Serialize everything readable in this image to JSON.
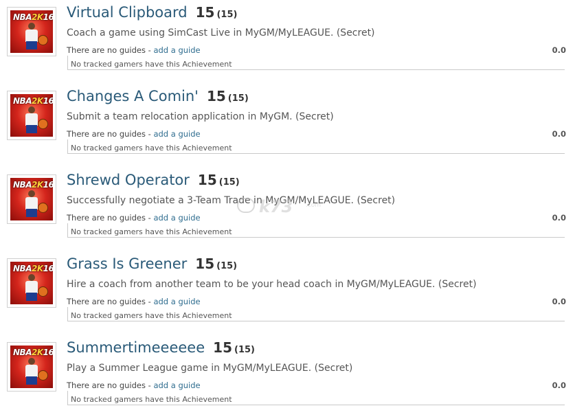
{
  "achievements": [
    {
      "title": "Virtual Clipboard",
      "points": "15",
      "points_sub": "(15)",
      "description": "Coach a game using SimCast Live in MyGM/MyLEAGUE. (Secret)",
      "guides_text": "There are no guides - ",
      "add_guide_label": "add a guide",
      "ratio": "0.0",
      "tracked_text": "No tracked gamers have this Achievement"
    },
    {
      "title": "Changes A Comin'",
      "points": "15",
      "points_sub": "(15)",
      "description": "Submit a team relocation application in MyGM. (Secret)",
      "guides_text": "There are no guides - ",
      "add_guide_label": "add a guide",
      "ratio": "0.0",
      "tracked_text": "No tracked gamers have this Achievement"
    },
    {
      "title": "Shrewd Operator",
      "points": "15",
      "points_sub": "(15)",
      "description": "Successfully negotiate a 3-Team Trade in MyGM/MyLEAGUE. (Secret)",
      "guides_text": "There are no guides - ",
      "add_guide_label": "add a guide",
      "ratio": "0.0",
      "tracked_text": "No tracked gamers have this Achievement"
    },
    {
      "title": "Grass Is Greener",
      "points": "15",
      "points_sub": "(15)",
      "description": "Hire a coach from another team to be your head coach in MyGM/MyLEAGUE. (Secret)",
      "guides_text": "There are no guides - ",
      "add_guide_label": "add a guide",
      "ratio": "0.0",
      "tracked_text": "No tracked gamers have this Achievement"
    },
    {
      "title": "Summertimeeeeee",
      "points": "15",
      "points_sub": "(15)",
      "description": "Play a Summer League game in MyGM/MyLEAGUE. (Secret)",
      "guides_text": "There are no guides - ",
      "add_guide_label": "add a guide",
      "ratio": "0.0",
      "tracked_text": "No tracked gamers have this Achievement"
    }
  ],
  "game_logo": {
    "brand": "NBA",
    "k": "2K",
    "year": "16"
  },
  "watermark": {
    "text": "k73",
    "sub": ".com"
  },
  "colors": {
    "title": "#2a5a78",
    "link": "#2f6d8f",
    "divider": "#c9c9c9",
    "cover_red": "#d4251c"
  }
}
